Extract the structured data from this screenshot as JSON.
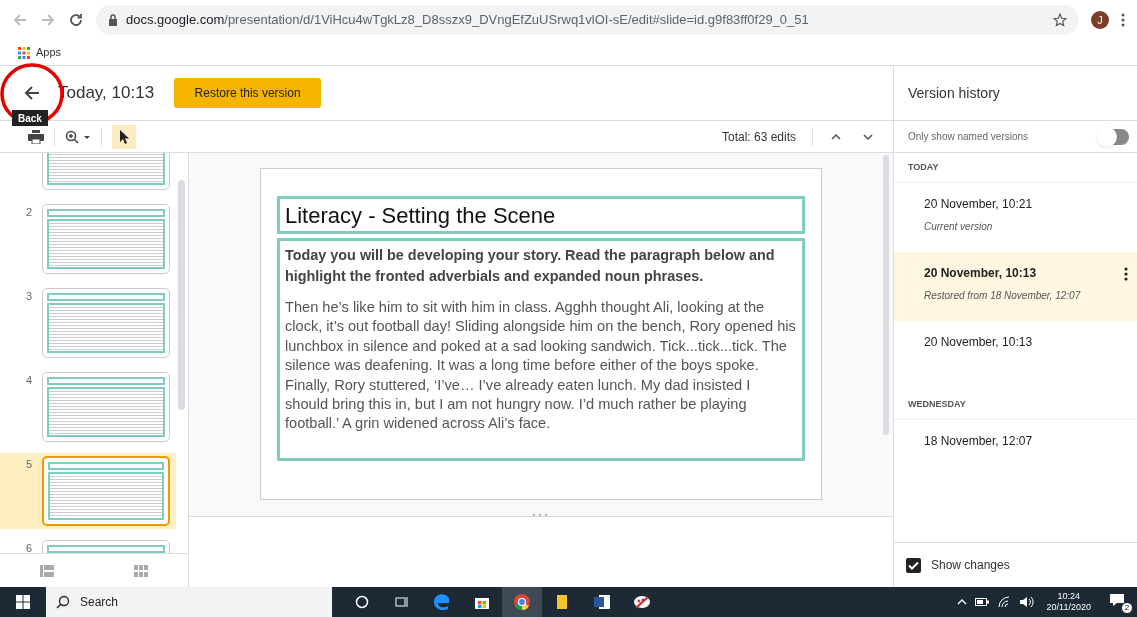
{
  "browser": {
    "url_host": "docs.google.com",
    "url_path": "/presentation/d/1ViHcu4wTgkLz8_D8sszx9_DVngEfZuUSrwq1vlOI-sE/edit#slide=id.g9f83ff0f29_0_51",
    "avatar": "J",
    "bookmarks": [
      "Apps"
    ]
  },
  "header": {
    "title": "Today, 10:13",
    "restore_button": "Restore this version",
    "tooltip": "Back"
  },
  "toolbar": {
    "total": "Total: 63 edits"
  },
  "filmstrip": {
    "slides": [
      {
        "selected": false
      },
      {
        "number": "2",
        "selected": false
      },
      {
        "number": "3",
        "selected": false
      },
      {
        "number": "4",
        "selected": false
      },
      {
        "number": "5",
        "selected": true
      },
      {
        "number": "6",
        "selected": false
      }
    ]
  },
  "slide": {
    "title": "Literacy - Setting the Scene",
    "instruction": "Today you will be developing your story. Read the paragraph below and highlight the fronted adverbials and expanded noun phrases.",
    "body": "Then he’s like him to sit with him in class. Agghh thought Ali, looking at the clock, it’s out football day! Sliding alongside him on the bench, Rory opened his lunchbox in silence and poked at a sad looking sandwich. Tick...tick...tick. The silence was deafening. It was a long time before either of the boys spoke. Finally, Rory stuttered, ‘I’ve… I’ve already eaten lunch. My dad insisted I should bring this in, but I am not hungry now. I’d much rather be playing football.’ A grin widened across Ali’s face."
  },
  "version_history": {
    "title": "Version history",
    "named_toggle": {
      "label": "Only show named versions",
      "on": false
    },
    "groups": [
      {
        "heading": "TODAY",
        "versions": [
          {
            "date": "20 November, 10:21",
            "note": "Current version",
            "selected": false
          },
          {
            "date": "20 November, 10:13",
            "note": "Restored from 18 November, 12:07",
            "selected": true
          },
          {
            "date": "20 November, 10:13",
            "selected": false
          }
        ]
      },
      {
        "heading": "WEDNESDAY",
        "versions": [
          {
            "date": "18 November, 12:07",
            "selected": false
          }
        ]
      }
    ],
    "show_changes": {
      "label": "Show changes",
      "checked": true
    }
  },
  "taskbar": {
    "search": "Search",
    "time": "10:24",
    "date": "20/11/2020",
    "notifications": "2"
  }
}
